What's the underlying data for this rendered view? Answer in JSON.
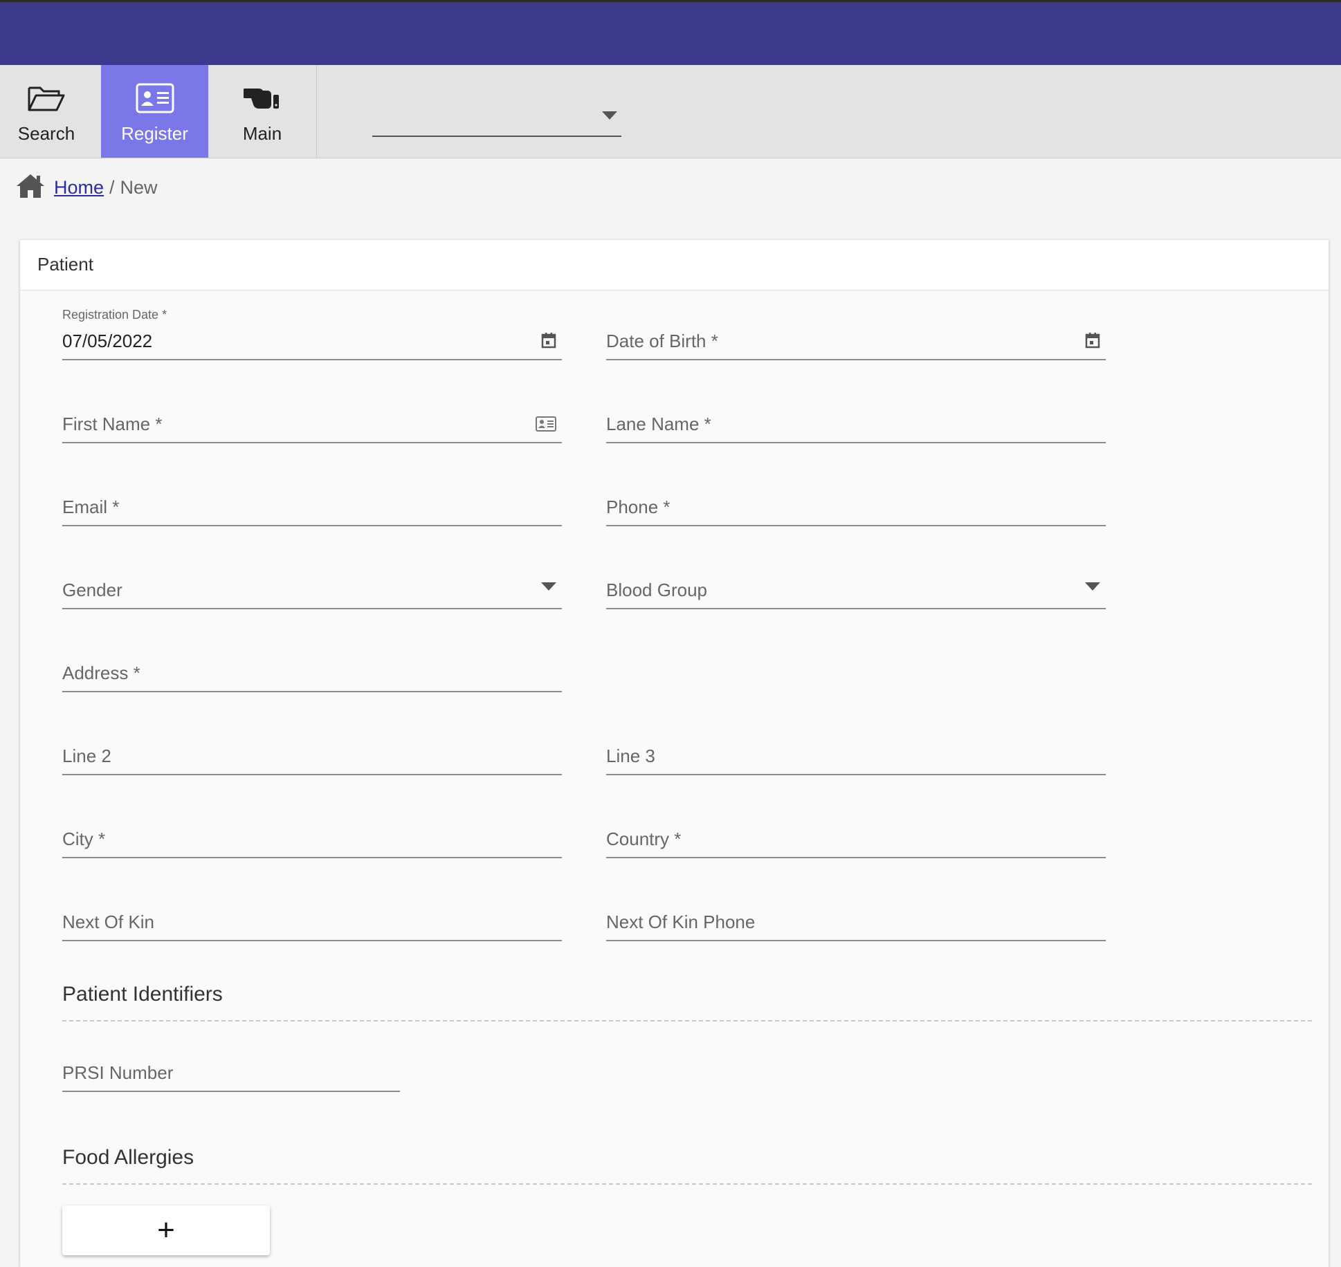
{
  "toolbar": {
    "search_label": "Search",
    "register_label": "Register",
    "main_label": "Main",
    "dropdown_value": ""
  },
  "breadcrumb": {
    "home": "Home",
    "separator": "/",
    "current": "New"
  },
  "card": {
    "title": "Patient"
  },
  "form": {
    "registration_date": {
      "label": "Registration Date *",
      "value": "07/05/2022"
    },
    "date_of_birth": {
      "label": "Date of Birth *"
    },
    "first_name": {
      "label": "First Name *"
    },
    "lane_name": {
      "label": "Lane Name *"
    },
    "email": {
      "label": "Email *"
    },
    "phone": {
      "label": "Phone *"
    },
    "gender": {
      "label": "Gender"
    },
    "blood_group": {
      "label": "Blood Group"
    },
    "address": {
      "label": "Address *"
    },
    "line2": {
      "label": "Line 2"
    },
    "line3": {
      "label": "Line 3"
    },
    "city": {
      "label": "City *"
    },
    "country": {
      "label": "Country *"
    },
    "next_of_kin": {
      "label": "Next Of Kin"
    },
    "next_of_kin_phone": {
      "label": "Next Of Kin Phone"
    }
  },
  "sections": {
    "identifiers_title": "Patient Identifiers",
    "prsi_label": "PRSI Number",
    "food_allergies_title": "Food Allergies",
    "add_label": "+"
  },
  "colors": {
    "topbar": "#3c3a8c",
    "active_tab": "#7a78e8",
    "link": "#2c2c9a"
  },
  "icons": {
    "search": "folder-open-icon",
    "register": "id-card-icon",
    "main": "pointing-hand-icon",
    "home": "home-icon",
    "calendar": "calendar-icon",
    "contact_card": "contact-card-icon",
    "dropdown": "caret-down-icon"
  }
}
